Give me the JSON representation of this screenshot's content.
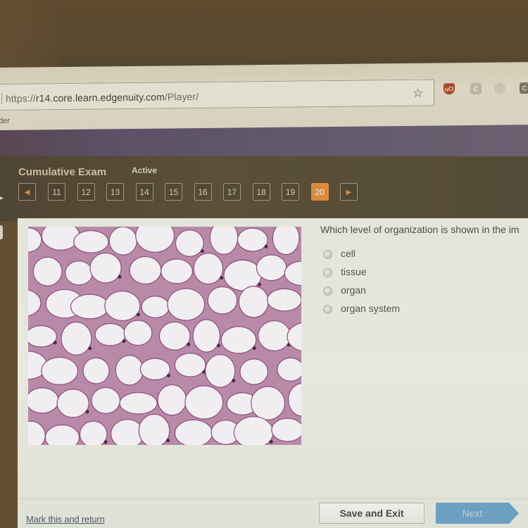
{
  "browser": {
    "url_prefix": "https://",
    "url_domain": "r14.core.learn.edgenuity.com",
    "url_path": "/Player/",
    "bookmark_partial": "der",
    "icons": [
      "star-icon",
      "ublock-origin-icon",
      "extension-icon",
      "extension-icon",
      "extension-icon"
    ],
    "ublock_label": "uO",
    "ext_label": "C"
  },
  "exam": {
    "title": "Cumulative Exam",
    "status": "Active",
    "prev_label": "◀",
    "next_label": "▶",
    "questions": [
      "11",
      "12",
      "13",
      "14",
      "15",
      "16",
      "17",
      "18",
      "19",
      "20"
    ],
    "current_question": "20",
    "accent_color": "#d98a3f"
  },
  "question": {
    "prompt": "Which level of organization is shown in the im",
    "image_alt": "micrograph of adipose tissue cells",
    "options": [
      {
        "label": "cell",
        "selected": false
      },
      {
        "label": "tissue",
        "selected": false
      },
      {
        "label": "organ",
        "selected": false
      },
      {
        "label": "organ system",
        "selected": false
      }
    ]
  },
  "footer": {
    "mark_link": "Mark this and return",
    "save_exit": "Save and Exit",
    "next": "Next",
    "next_color": "#6d9fc0"
  }
}
